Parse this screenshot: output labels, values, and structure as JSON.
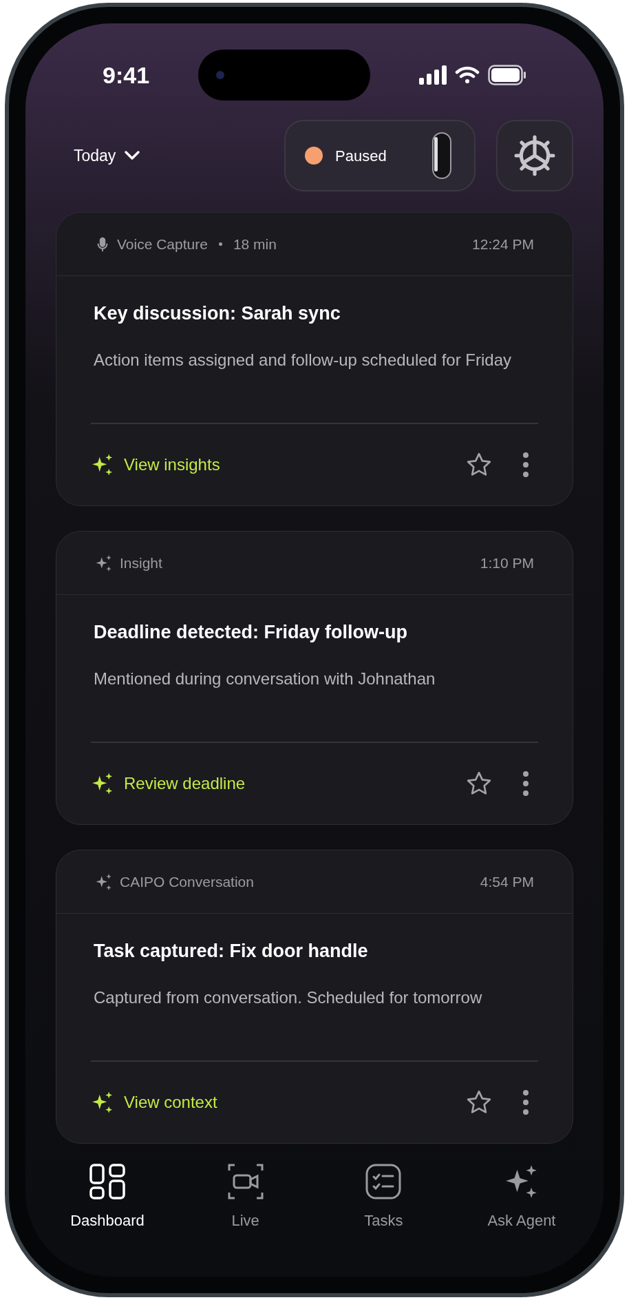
{
  "status_bar": {
    "time": "9:41"
  },
  "header": {
    "date_filter": "Today",
    "device_status": {
      "label": "Paused",
      "color": "#f6a070"
    }
  },
  "cards": [
    {
      "kind": "voice",
      "source": "Voice Capture",
      "duration": "18 min",
      "time": "12:24 PM",
      "title": "Key discussion: Sarah sync",
      "description": "Action items assigned and follow-up scheduled for Friday",
      "action": "View insights",
      "starred": false
    },
    {
      "kind": "insight",
      "source": "Insight",
      "time": "1:10 PM",
      "title": "Deadline detected: Friday follow-up",
      "description": "Mentioned during conversation with Johnathan",
      "action": "Review deadline",
      "starred": false
    },
    {
      "kind": "insight",
      "source": "CAIPO Conversation",
      "time": "4:54 PM",
      "title": "Task captured: Fix door handle",
      "description": "Captured from conversation. Scheduled for tomorrow",
      "action": "View context",
      "starred": false
    }
  ],
  "nav": [
    {
      "kind": "dashboard",
      "label": "Dashboard",
      "selected": true
    },
    {
      "kind": "live",
      "label": "Live",
      "selected": false
    },
    {
      "kind": "tasks",
      "label": "Tasks",
      "selected": false
    },
    {
      "kind": "agent",
      "label": "Ask Agent",
      "selected": false
    }
  ]
}
